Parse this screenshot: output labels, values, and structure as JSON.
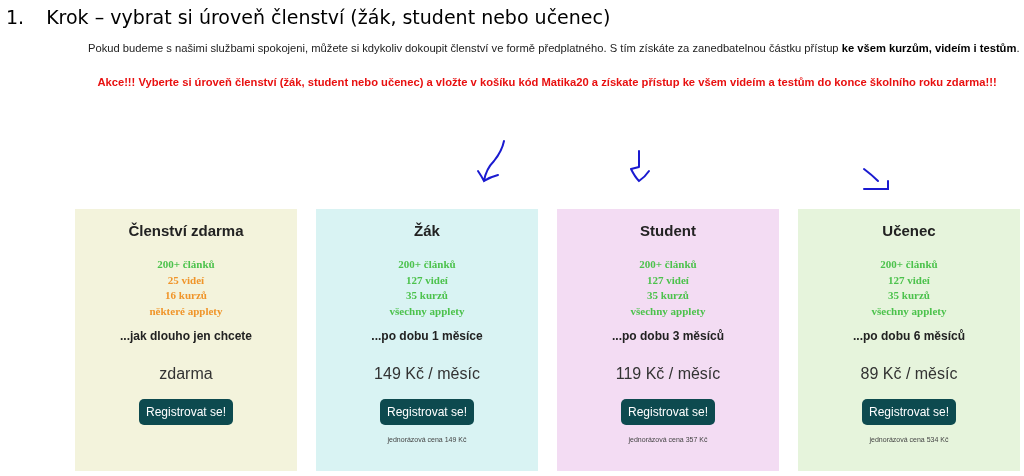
{
  "heading": {
    "number": "1.",
    "text": "Krok – vybrat si úroveň členství (žák, student nebo učenec)"
  },
  "intro": "Pokud budeme s našimi službami spokojeni, můžete si kdykoliv dokoupit členství ve formě předplatného. S tím získáte za zanedbatelnou částku přístup **ke všem kurzům, videím i testům**.",
  "promo": "Akce!!! Vyberte si úroveň členství (žák, student nebo učenec) a vložte v košíku kód Matika20 a získate přístup ke všem videím a testům do konce školního roku zdarma!!!",
  "plans": [
    {
      "title": "Členství zdarma",
      "color": "#f3f3dc",
      "features": [
        {
          "text": "200+ článků",
          "color": "#4cc24c"
        },
        {
          "text": "25 videí",
          "color": "#f0952a"
        },
        {
          "text": "16 kurzů",
          "color": "#f0952a"
        },
        {
          "text": "některé applety",
          "color": "#f0952a"
        }
      ],
      "duration": "...jak dlouho jen chcete",
      "price": "zdarma",
      "button": "Registrovat se!"
    },
    {
      "title": "Žák",
      "color": "#d9f3f3",
      "features": [
        {
          "text": "200+ článků",
          "color": "#4cc24c"
        },
        {
          "text": "127 videí",
          "color": "#4cc24c"
        },
        {
          "text": "35 kurzů",
          "color": "#4cc24c"
        },
        {
          "text": "všechny applety",
          "color": "#4cc24c"
        }
      ],
      "duration": "...po dobu 1 měsíce",
      "price": "149 Kč / měsíc",
      "button": "Registrovat se!",
      "note": "jednorázová cena 149 Kč"
    },
    {
      "title": "Student",
      "color": "#f3dcf3",
      "features": [
        {
          "text": "200+ článků",
          "color": "#4cc24c"
        },
        {
          "text": "127 videí",
          "color": "#4cc24c"
        },
        {
          "text": "35 kurzů",
          "color": "#4cc24c"
        },
        {
          "text": "všechny applety",
          "color": "#4cc24c"
        }
      ],
      "duration": "...po dobu 3 měsíců",
      "price": "119 Kč / měsíc",
      "button": "Registrovat se!",
      "note": "jednorázová cena 357 Kč"
    },
    {
      "title": "Učenec",
      "color": "#e6f4dc",
      "features": [
        {
          "text": "200+ článků",
          "color": "#4cc24c"
        },
        {
          "text": "127 videí",
          "color": "#4cc24c"
        },
        {
          "text": "35 kurzů",
          "color": "#4cc24c"
        },
        {
          "text": "všechny applety",
          "color": "#4cc24c"
        }
      ],
      "duration": "...po dobu 6 měsíců",
      "price": "89 Kč / měsíc",
      "button": "Registrovat se!",
      "note": "jednorázová cena 534 Kč"
    }
  ]
}
